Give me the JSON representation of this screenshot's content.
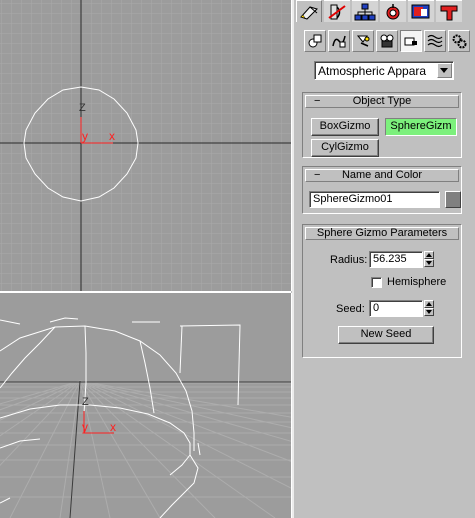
{
  "command_panel": {
    "tabs": [
      {
        "name": "create-tab",
        "icon": "create-icon"
      },
      {
        "name": "modify-tab",
        "icon": "modify-icon"
      },
      {
        "name": "hierarchy-tab",
        "icon": "hierarchy-icon"
      },
      {
        "name": "motion-tab",
        "icon": "motion-icon"
      },
      {
        "name": "display-tab",
        "icon": "display-icon"
      },
      {
        "name": "utilities-tab",
        "icon": "utilities-icon"
      }
    ],
    "categories": [
      {
        "name": "geometry",
        "icon": "geometry-icon"
      },
      {
        "name": "shapes",
        "icon": "shapes-icon"
      },
      {
        "name": "lights",
        "icon": "lights-icon"
      },
      {
        "name": "cameras",
        "icon": "camera-icon"
      },
      {
        "name": "helpers",
        "icon": "helpers-icon"
      },
      {
        "name": "space-warps",
        "icon": "space-warps-icon"
      },
      {
        "name": "systems",
        "icon": "systems-icon"
      }
    ],
    "subcategory": "Atmospheric Appara"
  },
  "object_type": {
    "title": "Object Type",
    "collapse_symbol": "−",
    "buttons": [
      "BoxGizmo",
      "SphereGizm",
      "CylGizmo"
    ]
  },
  "name_and_color": {
    "title": "Name and Color",
    "collapse_symbol": "−",
    "name_value": "SphereGizmo01",
    "color": "#808080"
  },
  "sphere_gizmo_parameters": {
    "title": "Sphere Gizmo Parameters",
    "radius_label": "Radius:",
    "radius_value": "56.235",
    "hemisphere_label": "Hemisphere",
    "hemisphere_checked": false,
    "seed_label": "Seed:",
    "seed_value": "0",
    "new_seed_label": "New Seed"
  },
  "viewports": {
    "top": {
      "axis_z": "Z",
      "axis_y": "y",
      "axis_x": "x"
    },
    "perspective": {
      "axis_z": "Z",
      "axis_y": "y",
      "axis_x": "x"
    }
  },
  "colors": {
    "viewport_bg": "#9c9c9c",
    "grid": "#a9a9a9",
    "gizmo": "#ffffff",
    "x_axis": "#ff2020",
    "active_button": "#7cf07c"
  }
}
